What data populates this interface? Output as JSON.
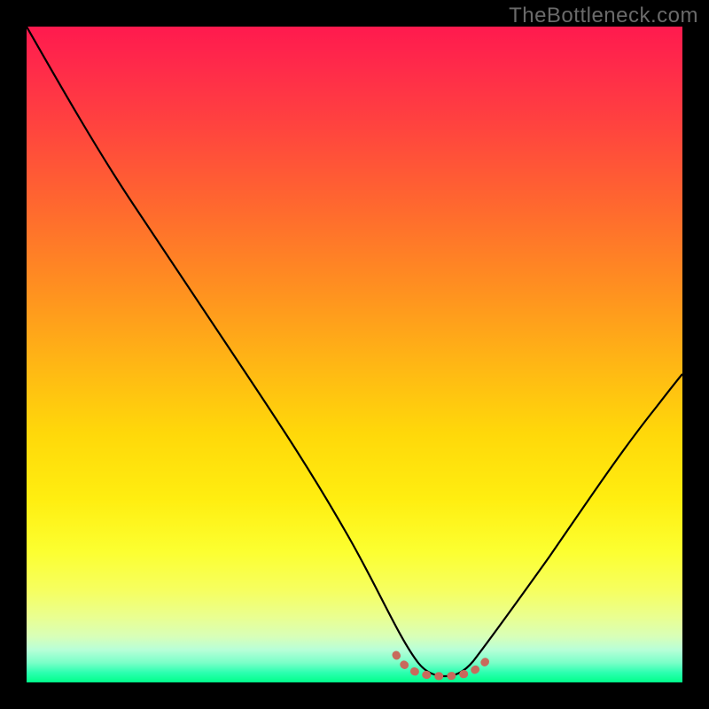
{
  "watermark": "TheBottleneck.com",
  "colors": {
    "frame": "#000000",
    "curve": "#000000",
    "marker": "#c86a5c",
    "watermark": "#6a6a6a"
  },
  "chart_data": {
    "type": "line",
    "title": "",
    "xlabel": "",
    "ylabel": "",
    "xlim": [
      0,
      100
    ],
    "ylim": [
      0,
      100
    ],
    "grid": false,
    "legend": false,
    "gradient_stops": [
      {
        "pos": 0,
        "color": "#ff1a4e"
      },
      {
        "pos": 0.14,
        "color": "#ff4040"
      },
      {
        "pos": 0.4,
        "color": "#ff9020"
      },
      {
        "pos": 0.62,
        "color": "#ffd80a"
      },
      {
        "pos": 0.8,
        "color": "#fcff30"
      },
      {
        "pos": 0.93,
        "color": "#d8ffb8"
      },
      {
        "pos": 1.0,
        "color": "#00ff8a"
      }
    ],
    "series": [
      {
        "name": "bottleneck-curve",
        "x": [
          0,
          4,
          8,
          12,
          16,
          20,
          24,
          28,
          32,
          36,
          40,
          44,
          48,
          52,
          55,
          58,
          61,
          64,
          67,
          70,
          74,
          78,
          82,
          86,
          90,
          94,
          98,
          100
        ],
        "y": [
          100,
          92,
          84,
          77,
          70,
          63,
          56,
          49,
          43,
          37,
          31,
          25,
          20,
          15,
          10,
          6,
          3,
          1,
          1,
          2,
          5,
          9,
          14,
          20,
          27,
          34,
          42,
          46
        ]
      },
      {
        "name": "floor-marker",
        "x": [
          56,
          58,
          60,
          62,
          64,
          66,
          68
        ],
        "y": [
          3.0,
          1.8,
          1.2,
          1.0,
          1.2,
          1.8,
          3.0
        ]
      }
    ],
    "minimum_x_range": [
      56,
      68
    ]
  }
}
